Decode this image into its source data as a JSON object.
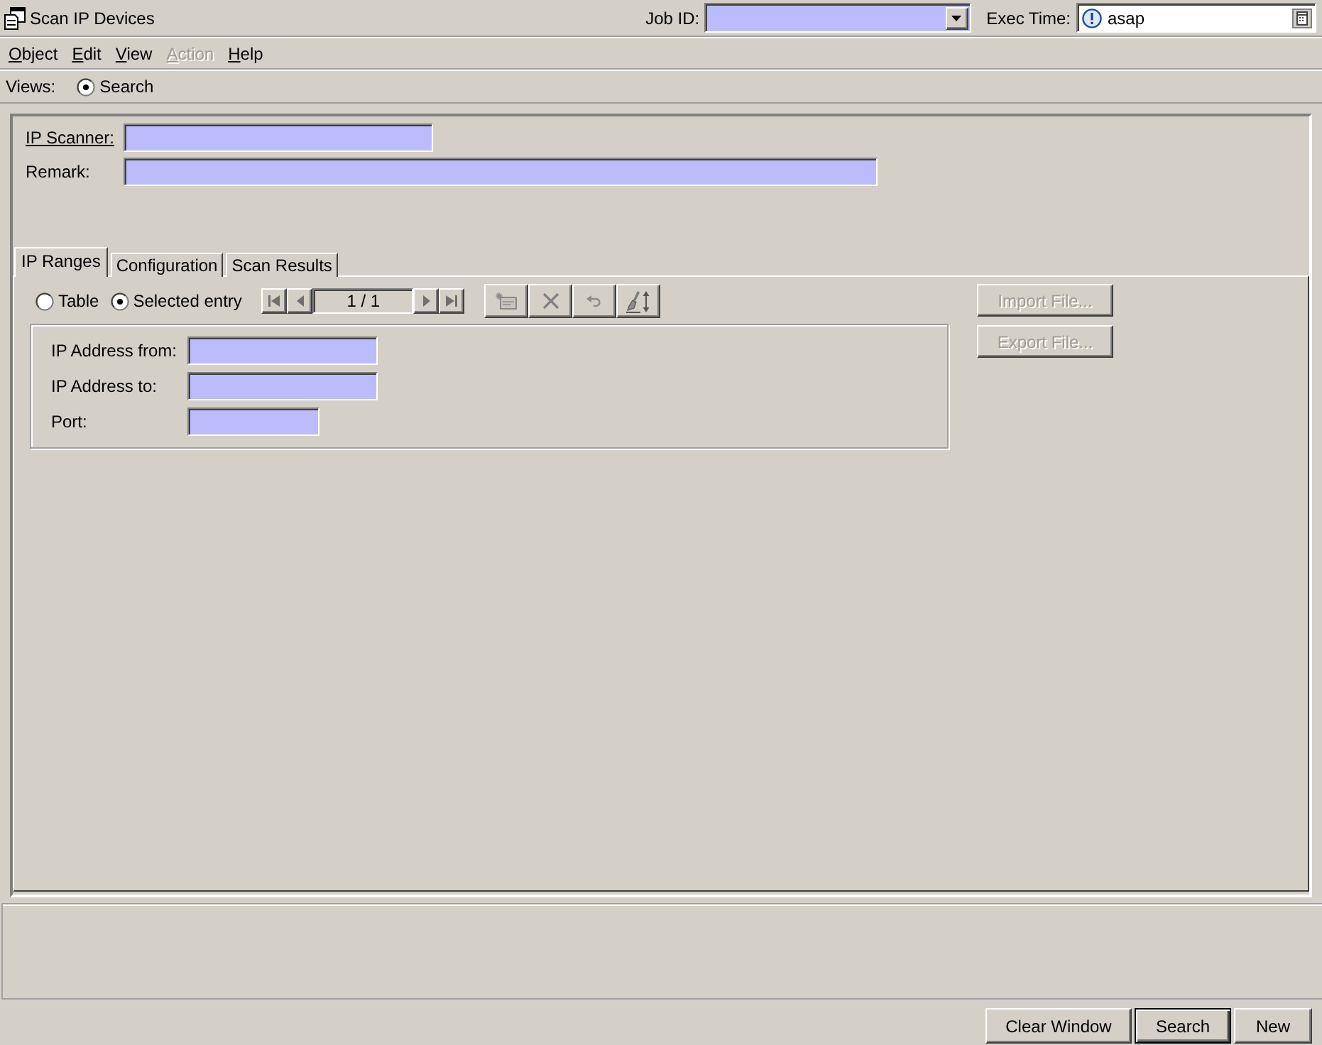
{
  "window": {
    "title": "Scan IP Devices"
  },
  "header": {
    "job_id": {
      "label": "Job ID:"
    },
    "exec_time": {
      "label": "Exec Time:",
      "value": "asap"
    }
  },
  "menu": [
    {
      "label": "Object",
      "disabled": false
    },
    {
      "label": "Edit",
      "disabled": false
    },
    {
      "label": "View",
      "disabled": false
    },
    {
      "label": "Action",
      "disabled": true
    },
    {
      "label": "Help",
      "disabled": false
    }
  ],
  "views": {
    "label": "Views:",
    "options": [
      {
        "label": "Search",
        "selected": true
      }
    ]
  },
  "form": {
    "fields": [
      {
        "label": "IP Scanner:",
        "link": true
      },
      {
        "label": "Remark:",
        "link": false
      }
    ]
  },
  "tabs": [
    {
      "label": "IP Ranges",
      "selected": true
    },
    {
      "label": "Configuration",
      "selected": false
    },
    {
      "label": "Scan Results",
      "selected": false
    }
  ],
  "ip_ranges": {
    "modes": [
      {
        "label": "Table",
        "selected": false
      },
      {
        "label": "Selected entry",
        "selected": true
      }
    ],
    "pager": {
      "position": "1 / 1"
    },
    "entry_fields": [
      {
        "label": "IP Address from:"
      },
      {
        "label": "IP Address to:"
      },
      {
        "label": "Port:"
      }
    ],
    "side_buttons": [
      {
        "label": "Import File...",
        "disabled": true
      },
      {
        "label": "Export File...",
        "disabled": true
      }
    ]
  },
  "footer_buttons": [
    {
      "label": "Clear Window",
      "default": false
    },
    {
      "label": "Search",
      "default": true
    },
    {
      "label": "New",
      "default": false
    }
  ]
}
